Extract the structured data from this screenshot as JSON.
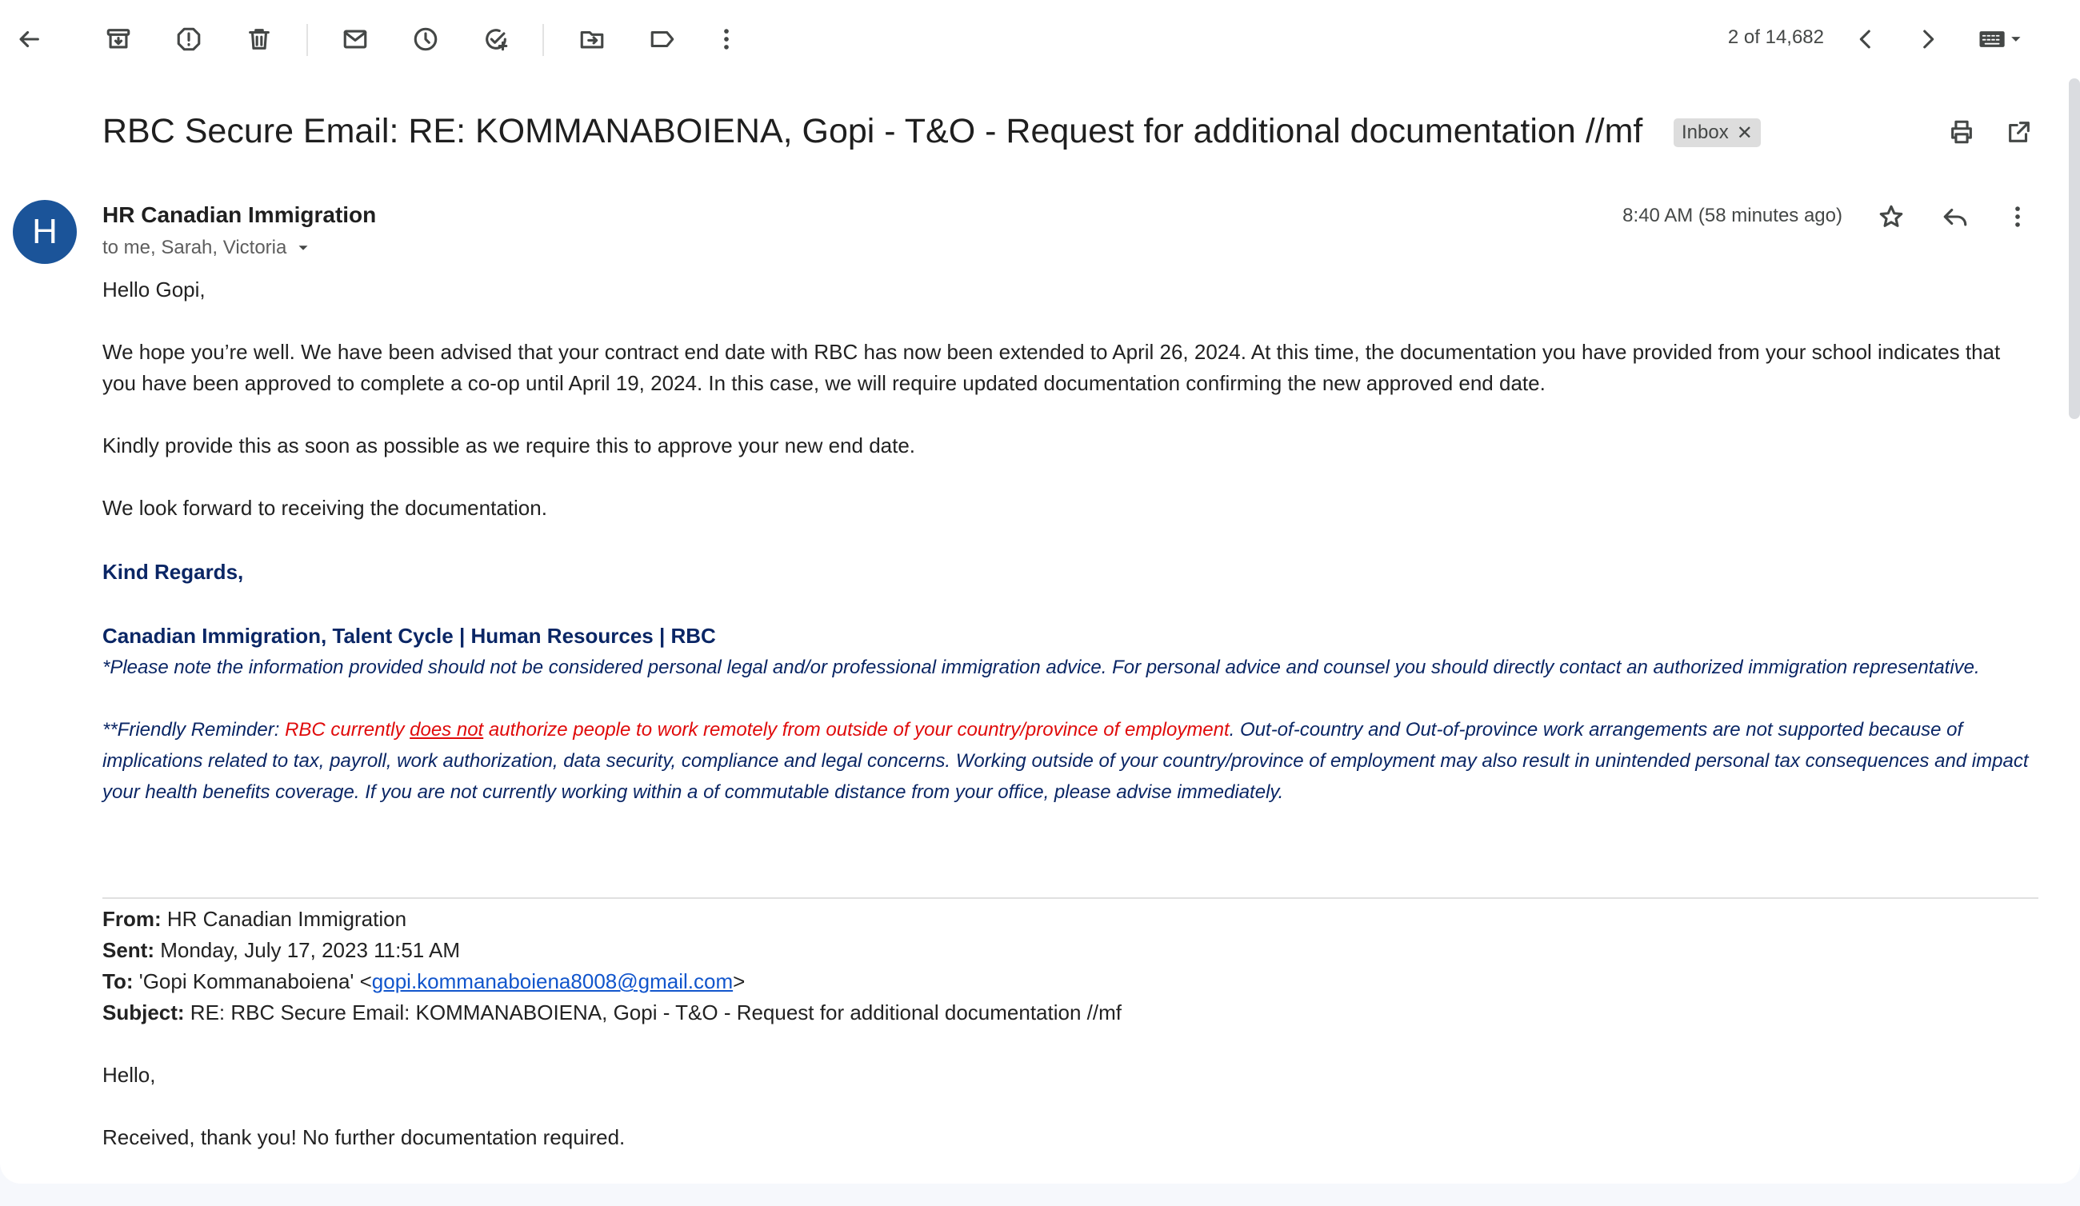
{
  "toolbar": {
    "pager_text": "2 of 14,682"
  },
  "subject": "RBC Secure Email: RE: KOMMANABOIENA, Gopi - T&O - Request for additional documentation //mf",
  "label_badge": "Inbox",
  "sender": {
    "initial": "H",
    "name": "HR Canadian Immigration",
    "recipients": "to me, Sarah, Victoria",
    "time": "8:40 AM (58 minutes ago)"
  },
  "message": {
    "greeting": "Hello Gopi,",
    "para1": "We hope you’re well. We have been advised that your contract end date with RBC has now been extended to April 26, 2024. At this time, the documentation you have provided from your school indicates that you have been approved to complete a co-op until April 19, 2024. In this case, we will require updated documentation confirming the new approved end date.",
    "para2": "Kindly provide this as soon as possible as we require this to approve your new end date.",
    "para3": "We look forward  to receiving the documentation.",
    "regards": "Kind Regards,",
    "signature": "Canadian Immigration, Talent Cycle | Human Resources | RBC",
    "disclaimer": "*Please note the information provided should not be considered personal legal and/or professional immigration advice.  For personal advice and counsel you should directly contact an authorized immigration representative.",
    "reminder_prefix": "**Friendly Reminder: ",
    "reminder_red1": "RBC currently ",
    "reminder_red_underline": "does not",
    "reminder_red2": " authorize people to work remotely from outside of your country/province of employment",
    "reminder_rest": ". Out-of-country and Out-of-province work arrangements are not supported because of implications related to tax, payroll, work authorization, data security, compliance and legal concerns. Working outside of your country/province of employment may also result in unintended personal tax consequences and impact your health benefits coverage. If you are not currently working within a of commutable distance from your office, please advise immediately."
  },
  "quoted": {
    "from_label": "From:",
    "from_value": " HR Canadian Immigration",
    "sent_label": "Sent:",
    "sent_value": " Monday, July 17, 2023 11:51 AM",
    "to_label": "To:",
    "to_value_prefix": " 'Gopi Kommanaboiena' <",
    "to_email": "gopi.kommanaboiena8008@gmail.com",
    "to_value_suffix": ">",
    "subject_label": "Subject:",
    "subject_value": " RE: RBC Secure Email: KOMMANABOIENA, Gopi - T&O - Request for additional documentation //mf",
    "greeting": "Hello,",
    "line1": "Received, thank you! No further documentation required."
  },
  "colors": {
    "avatar": "#1b5499",
    "signature": "#0a2665",
    "reminder_red": "#e00b0b",
    "link": "#1155cc"
  },
  "icons": [
    "back-arrow-icon",
    "archive-icon",
    "report-spam-icon",
    "delete-icon",
    "mark-unread-icon",
    "snooze-icon",
    "add-task-icon",
    "move-to-icon",
    "label-icon",
    "more-vert-icon",
    "chevron-left-icon",
    "chevron-right-icon",
    "keyboard-icon",
    "print-icon",
    "open-in-new-window-icon",
    "star-icon",
    "reply-icon"
  ]
}
